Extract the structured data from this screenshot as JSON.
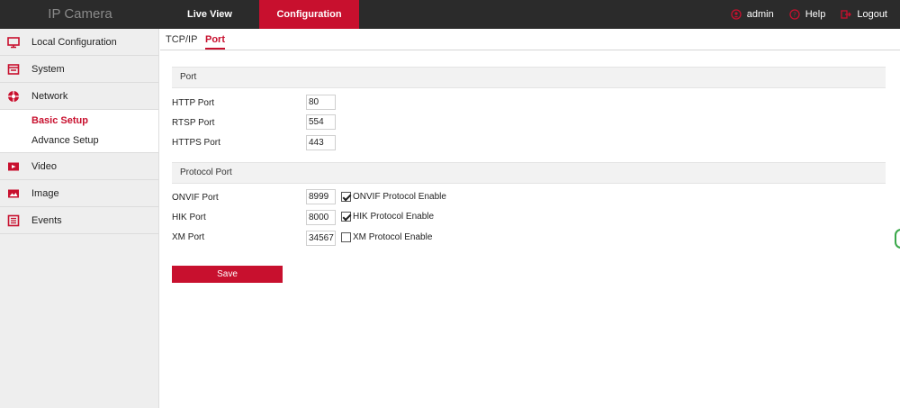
{
  "header": {
    "brand": "IP Camera",
    "tabs": [
      {
        "label": "Live View"
      },
      {
        "label": "Configuration"
      }
    ],
    "user": "admin",
    "help": "Help",
    "logout": "Logout"
  },
  "sidebar": {
    "items": [
      {
        "label": "Local Configuration",
        "icon": "monitor-icon"
      },
      {
        "label": "System",
        "icon": "system-icon"
      },
      {
        "label": "Network",
        "icon": "network-icon"
      },
      {
        "label": "Video",
        "icon": "video-icon"
      },
      {
        "label": "Image",
        "icon": "image-icon"
      },
      {
        "label": "Events",
        "icon": "events-icon"
      }
    ],
    "network_sub": [
      {
        "label": "Basic Setup"
      },
      {
        "label": "Advance Setup"
      }
    ]
  },
  "main": {
    "tabs": [
      {
        "label": "TCP/IP"
      },
      {
        "label": "Port"
      }
    ],
    "port_section": {
      "title": "Port",
      "fields": [
        {
          "label": "HTTP Port",
          "value": "80"
        },
        {
          "label": "RTSP Port",
          "value": "554"
        },
        {
          "label": "HTTPS Port",
          "value": "443"
        }
      ]
    },
    "protocol_section": {
      "title": "Protocol Port",
      "fields": [
        {
          "label": "ONVIF Port",
          "value": "8999",
          "check_label": "ONVIF Protocol Enable",
          "checked": true
        },
        {
          "label": "HIK Port",
          "value": "8000",
          "check_label": "HIK Protocol Enable",
          "checked": true
        },
        {
          "label": "XM Port",
          "value": "34567",
          "check_label": "XM Protocol Enable",
          "checked": false
        }
      ]
    },
    "save_label": "Save"
  },
  "colors": {
    "accent": "#c8102e",
    "topbar": "#2b2b2b",
    "sidebar": "#eeeeee"
  }
}
